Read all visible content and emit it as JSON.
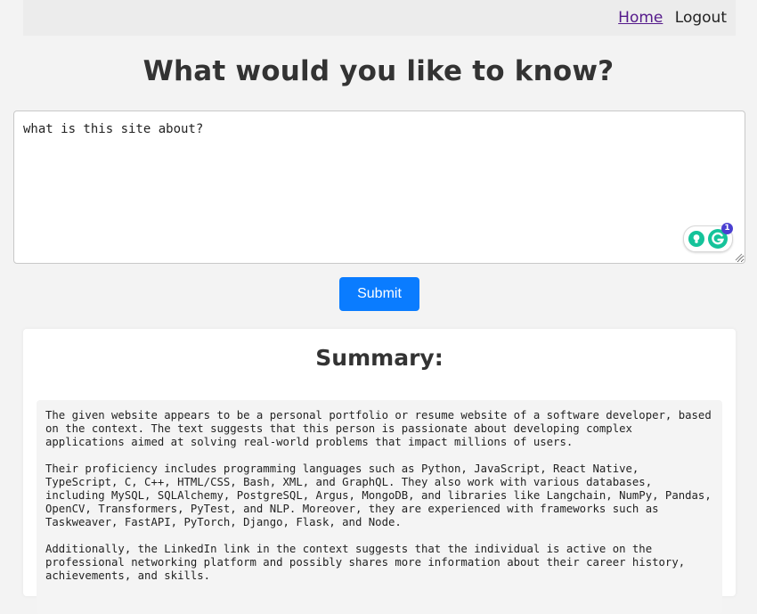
{
  "nav": {
    "home_label": "Home",
    "logout_label": "Logout"
  },
  "page": {
    "title": "What would you like to know?"
  },
  "question": {
    "value": "what is this site about?",
    "grammarly_badge_count": "1"
  },
  "form": {
    "submit_label": "Submit"
  },
  "summary": {
    "title": "Summary:",
    "paragraphs": [
      "The given website appears to be a personal portfolio or resume website of a software developer, based on the context. The text suggests that this person is passionate about developing complex applications aimed at solving real-world problems that impact millions of users.",
      "Their proficiency includes programming languages such as Python, JavaScript, React Native, TypeScript, C, C++, HTML/CSS, Bash, XML, and GraphQL. They also work with various databases, including MySQL, SQLAlchemy, PostgreSQL, Argus, MongoDB, and libraries like Langchain, NumPy, Pandas, OpenCV, Transformers, PyTest, and NLP. Moreover, they are experienced with frameworks such as Taskweaver, FastAPI, PyTorch, Django, Flask, and Node.",
      "Additionally, the LinkedIn link in the context suggests that the individual is active on the professional networking platform and possibly shares more information about their career history, achievements, and skills."
    ]
  },
  "icons": {
    "grammarly_bulb": "lightbulb-icon",
    "grammarly_logo": "grammarly-g-icon",
    "resize": "resize-grip-icon"
  },
  "colors": {
    "primary_button": "#0a7cff",
    "page_background": "#f3f3f3",
    "navbar_background": "#ececec",
    "visited_link": "#551a8b",
    "grammarly_green": "#15c39a",
    "grammarly_badge": "#4a3fd1"
  }
}
